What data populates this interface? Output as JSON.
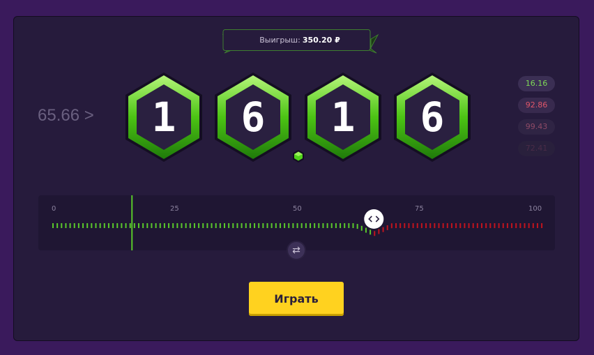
{
  "win": {
    "label": "Выигрыш:",
    "amount": "350.20 ₽"
  },
  "target": {
    "text": "65.66 >"
  },
  "digits": [
    "1",
    "6",
    "1",
    "6"
  ],
  "history": [
    {
      "value": "16.16",
      "color": "#7ed957"
    },
    {
      "value": "92.86",
      "color": "#e0566a"
    },
    {
      "value": "99.43",
      "color": "#8e4a66"
    },
    {
      "value": "72.41",
      "color": "#4a2c48"
    }
  ],
  "slider": {
    "min": 0,
    "max": 100,
    "labels": [
      "0",
      "25",
      "50",
      "75",
      "100"
    ],
    "value": 65.66,
    "result": 16.16,
    "win_color": "#59c92b",
    "lose_color": "#c0141e"
  },
  "play_button": {
    "label": "Играть"
  },
  "colors": {
    "accent": "#ffd21f",
    "hex_green": "#58d119"
  }
}
